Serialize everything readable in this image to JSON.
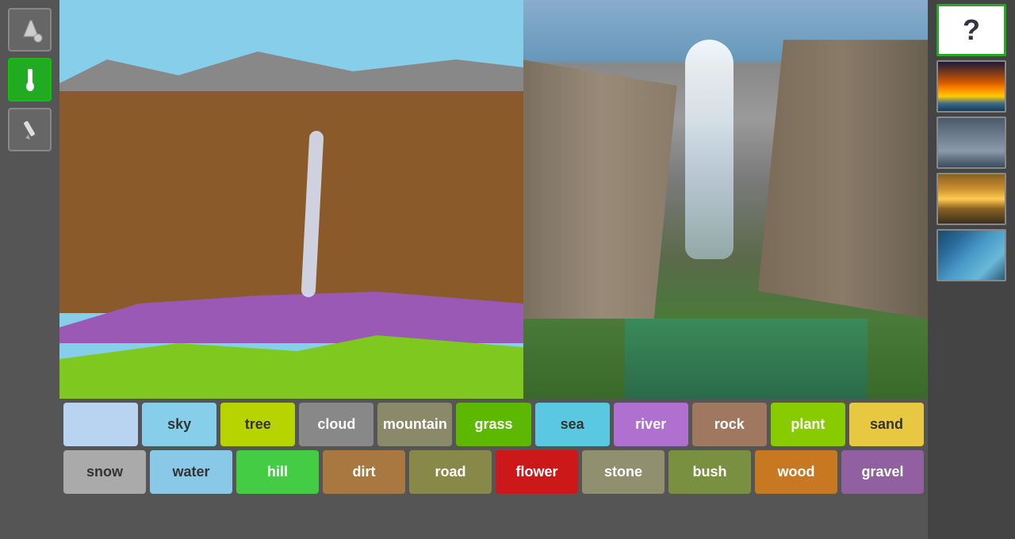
{
  "toolbar": {
    "tools": [
      {
        "name": "fill-tool",
        "label": "🪣"
      },
      {
        "name": "brush-tool",
        "label": "🖌"
      },
      {
        "name": "pencil-tool",
        "label": "✏"
      }
    ]
  },
  "right_sidebar": {
    "items": [
      {
        "name": "dice-thumb",
        "label": "?"
      },
      {
        "name": "sunset-thumb",
        "label": ""
      },
      {
        "name": "clouds-thumb",
        "label": ""
      },
      {
        "name": "golden-sky-thumb",
        "label": ""
      },
      {
        "name": "wave-thumb",
        "label": ""
      }
    ]
  },
  "label_buttons": {
    "row1": [
      {
        "id": "empty",
        "label": "",
        "class": "empty-btn"
      },
      {
        "id": "sky",
        "label": "sky",
        "class": "c-sky"
      },
      {
        "id": "tree",
        "label": "tree",
        "class": "c-tree"
      },
      {
        "id": "cloud",
        "label": "cloud",
        "class": "c-cloud"
      },
      {
        "id": "mountain",
        "label": "mountain",
        "class": "c-mountain"
      },
      {
        "id": "grass",
        "label": "grass",
        "class": "c-grass"
      },
      {
        "id": "sea",
        "label": "sea",
        "class": "c-sea"
      },
      {
        "id": "river",
        "label": "river",
        "class": "c-river"
      },
      {
        "id": "rock",
        "label": "rock",
        "class": "c-rock"
      },
      {
        "id": "plant",
        "label": "plant",
        "class": "c-plant"
      },
      {
        "id": "sand",
        "label": "sand",
        "class": "c-sand"
      }
    ],
    "row2": [
      {
        "id": "snow",
        "label": "snow",
        "class": "c-snow"
      },
      {
        "id": "water",
        "label": "water",
        "class": "c-water"
      },
      {
        "id": "hill",
        "label": "hill",
        "class": "c-hill"
      },
      {
        "id": "dirt",
        "label": "dirt",
        "class": "c-dirt"
      },
      {
        "id": "road",
        "label": "road",
        "class": "c-road"
      },
      {
        "id": "flower",
        "label": "flower",
        "class": "c-flower"
      },
      {
        "id": "stone",
        "label": "stone",
        "class": "c-stone"
      },
      {
        "id": "bush",
        "label": "bush",
        "class": "c-bush"
      },
      {
        "id": "wood",
        "label": "wood",
        "class": "c-wood"
      },
      {
        "id": "gravel",
        "label": "gravel",
        "class": "c-gravel"
      }
    ]
  }
}
